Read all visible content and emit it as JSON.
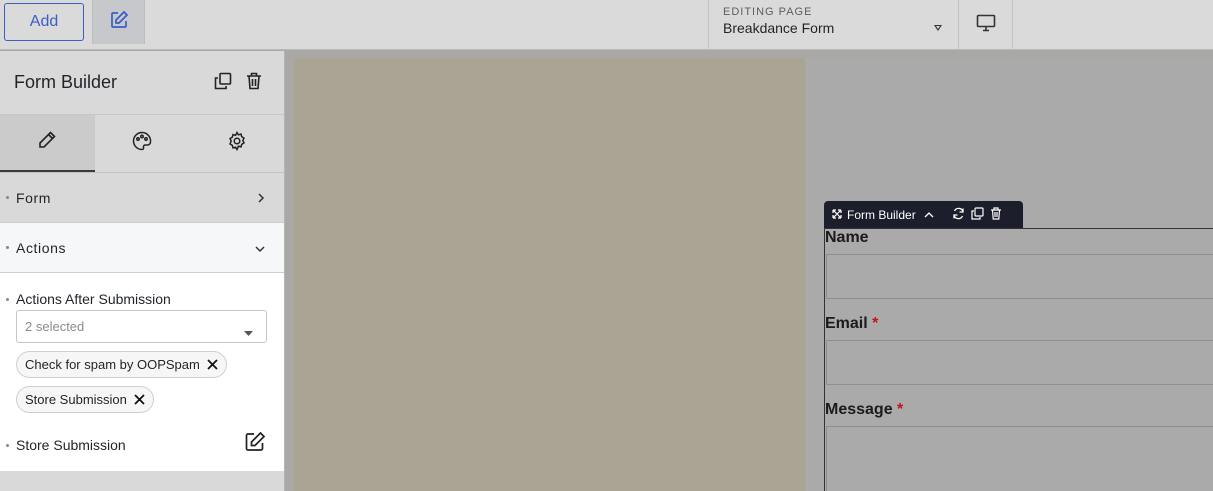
{
  "topbar": {
    "add_label": "Add",
    "editing_label": "EDITING PAGE",
    "editing_value": "Breakdance Form"
  },
  "panel": {
    "title": "Form Builder",
    "sections": {
      "form": "Form",
      "actions": "Actions"
    },
    "actions_after_label": "Actions After Submission",
    "multi_placeholder": "2 selected",
    "chips": [
      "Check for spam by OOPSpam",
      "Store Submission"
    ],
    "store_label": "Store Submission"
  },
  "canvas": {
    "toolbar_name": "Form Builder",
    "fields": [
      {
        "label": "Name",
        "required": ""
      },
      {
        "label": "Email",
        "required": "*"
      },
      {
        "label": "Message",
        "required": "*"
      }
    ]
  },
  "colors": {
    "accent": "#3a5fc4",
    "required": "#c0121d",
    "toolbar_bg": "#1c1f2b"
  }
}
